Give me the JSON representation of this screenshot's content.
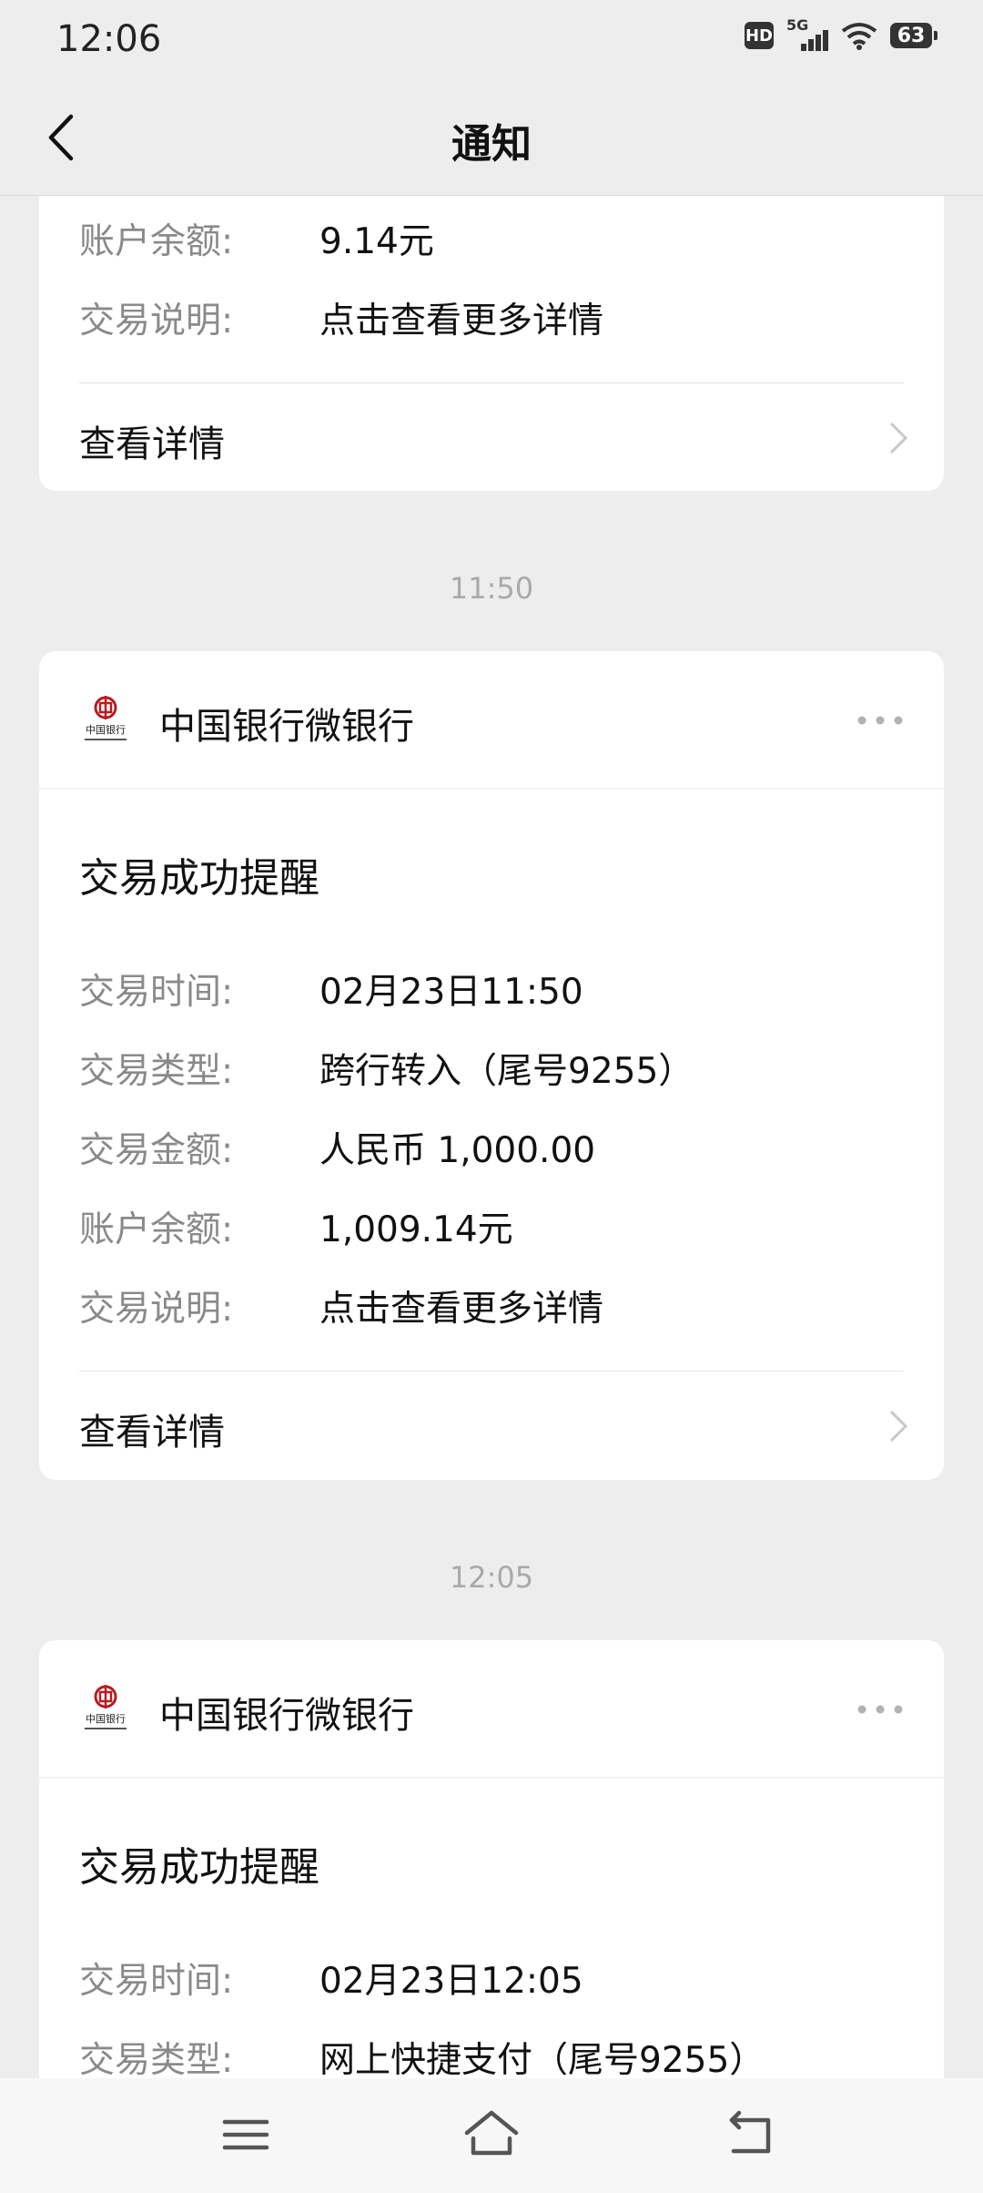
{
  "status": {
    "time": "12:06",
    "hd": "HD",
    "network": "5G",
    "battery": "63"
  },
  "header": {
    "title": "通知"
  },
  "top_card": {
    "rows": [
      {
        "key": "账户余额:",
        "value": "9.14元"
      },
      {
        "key": "交易说明:",
        "value": "点击查看更多详情"
      }
    ],
    "link": "查看详情"
  },
  "messages": [
    {
      "time": "11:50",
      "sender": "中国银行微银行",
      "title": "交易成功提醒",
      "rows": [
        {
          "key": "交易时间:",
          "value": "02月23日11:50"
        },
        {
          "key": "交易类型:",
          "value": "跨行转入（尾号9255）"
        },
        {
          "key": "交易金额:",
          "value": "人民币 1,000.00"
        },
        {
          "key": "账户余额:",
          "value": "1,009.14元"
        },
        {
          "key": "交易说明:",
          "value": "点击查看更多详情"
        }
      ],
      "link": "查看详情"
    },
    {
      "time": "12:05",
      "sender": "中国银行微银行",
      "title": "交易成功提醒",
      "rows": [
        {
          "key": "交易时间:",
          "value": "02月23日12:05"
        },
        {
          "key": "交易类型:",
          "value": "网上快捷支付（尾号9255）"
        }
      ]
    }
  ],
  "icons": {
    "back": "chevron-left-icon",
    "more": "more-dots-icon",
    "chevron": "chevron-right-icon",
    "logo": "bank-of-china-logo",
    "menu": "menu-icon",
    "home": "home-icon",
    "back_nav": "back-icon"
  },
  "colors": {
    "background": "#ededed",
    "card": "#ffffff",
    "muted": "#8a8a8a",
    "logo_red": "#b81c22"
  }
}
